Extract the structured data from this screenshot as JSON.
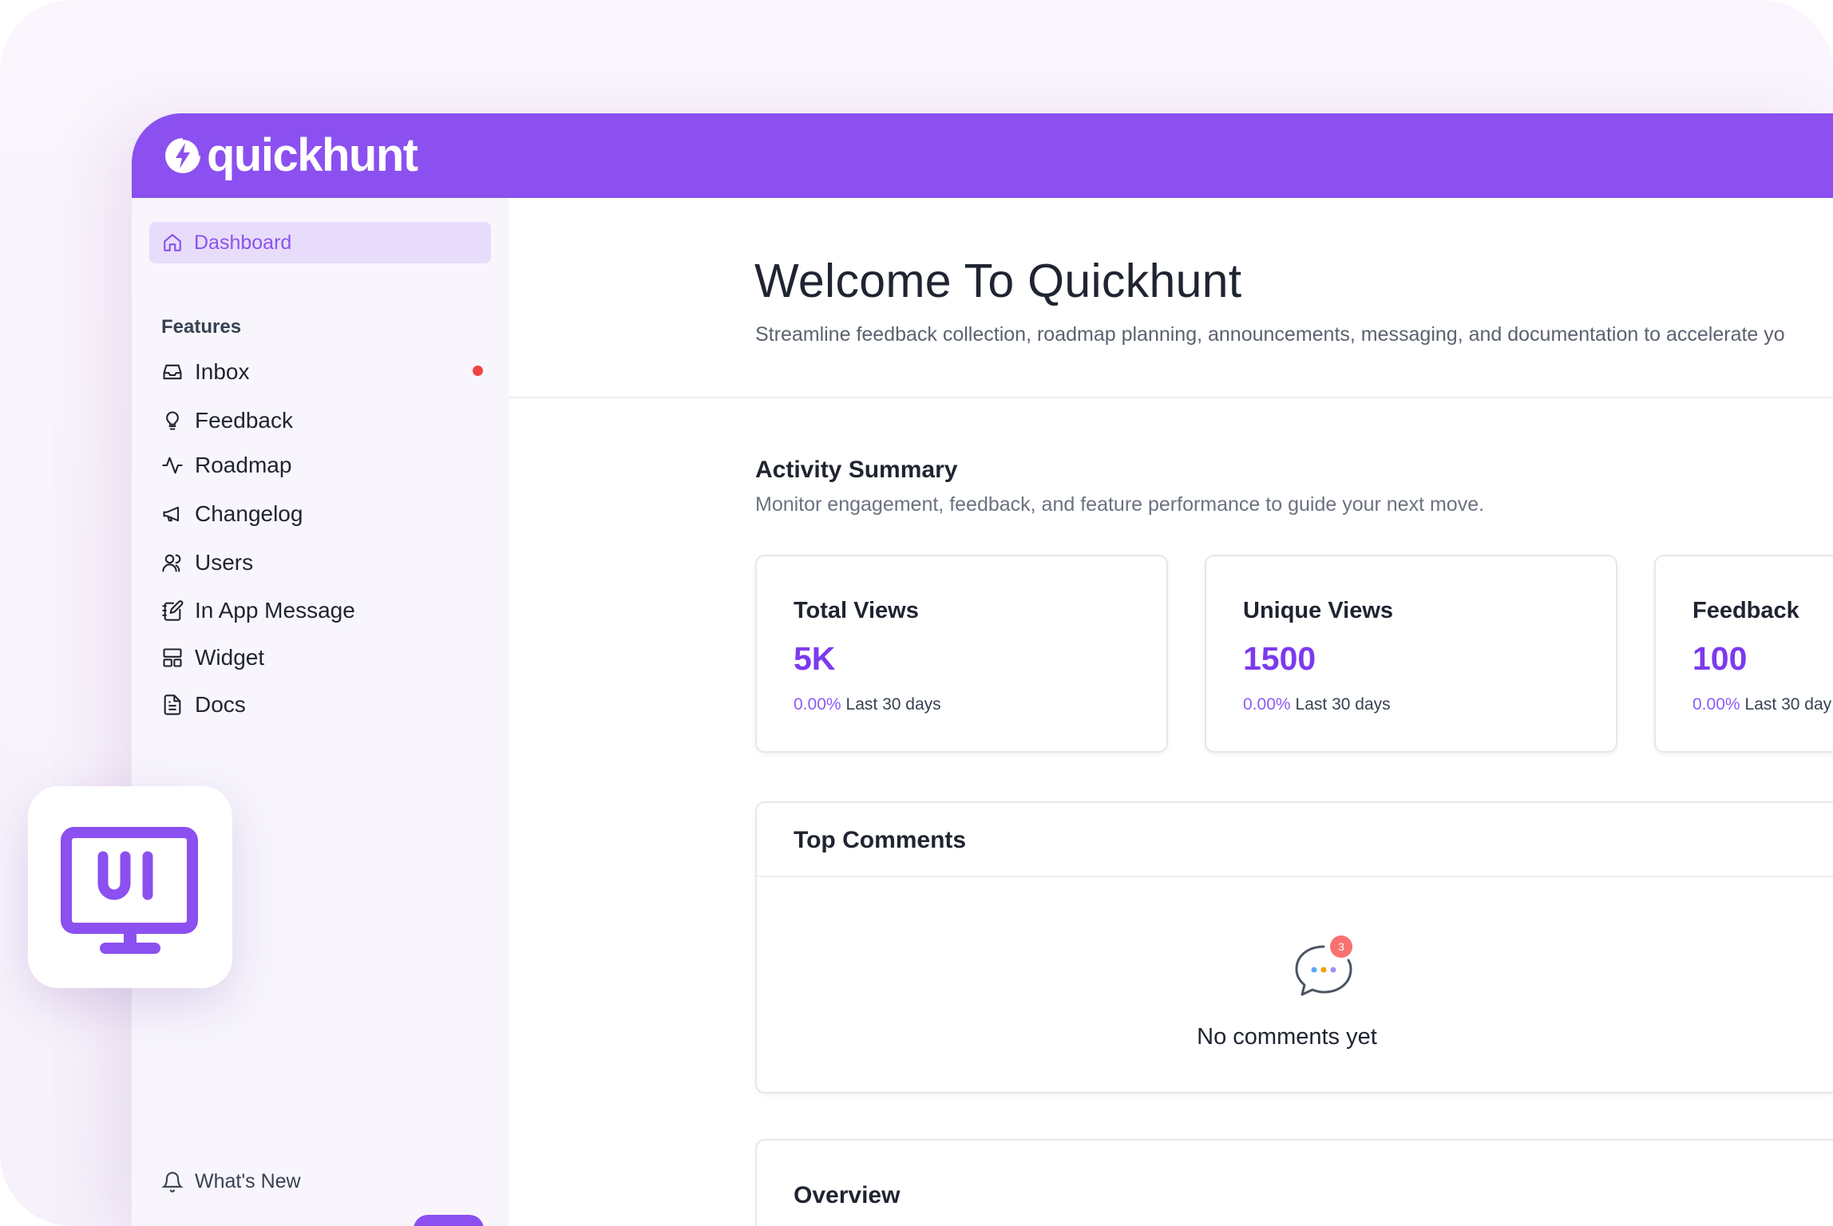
{
  "brand": {
    "name": "quickhunt",
    "color": "#8b50ef"
  },
  "sidebar": {
    "active": {
      "label": "Dashboard",
      "icon": "home-icon"
    },
    "section_label": "Features",
    "items": [
      {
        "label": "Inbox",
        "icon": "inbox-icon",
        "has_notification": true
      },
      {
        "label": "Feedback",
        "icon": "lightbulb-icon"
      },
      {
        "label": "Roadmap",
        "icon": "activity-icon"
      },
      {
        "label": "Changelog",
        "icon": "megaphone-icon"
      },
      {
        "label": "Users",
        "icon": "users-icon"
      },
      {
        "label": "In App Message",
        "icon": "notebook-pen-icon"
      },
      {
        "label": "Widget",
        "icon": "layout-icon"
      },
      {
        "label": "Docs",
        "icon": "document-icon"
      }
    ],
    "footer": {
      "whats_new": "What's New"
    }
  },
  "main": {
    "title": "Welcome To Quickhunt",
    "subtitle": "Streamline feedback collection, roadmap planning, announcements, messaging, and documentation to accelerate yo",
    "activity": {
      "title": "Activity Summary",
      "subtitle": "Monitor engagement, feedback, and feature performance to guide your next move.",
      "cards": [
        {
          "title": "Total Views",
          "value": "5K",
          "pct": "0.00%",
          "period": "Last 30 days"
        },
        {
          "title": "Unique Views",
          "value": "1500",
          "pct": "0.00%",
          "period": "Last 30 days"
        },
        {
          "title": "Feedback",
          "value": "100",
          "pct": "0.00%",
          "period": "Last 30 day"
        }
      ]
    },
    "top_comments": {
      "title": "Top Comments",
      "badge_count": "3",
      "empty_text": "No comments yet"
    },
    "overview": {
      "title": "Overview"
    }
  },
  "badge": {
    "text": "UI",
    "color": "#8b50ef"
  }
}
